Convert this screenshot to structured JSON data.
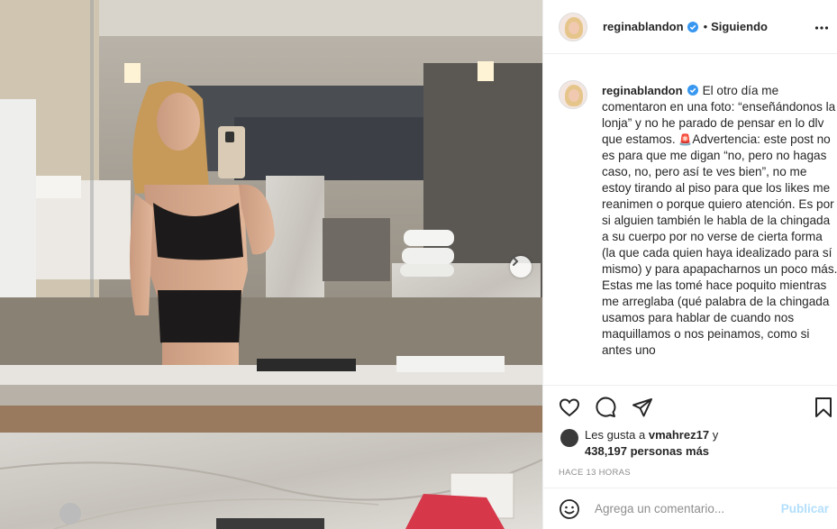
{
  "post": {
    "username": "reginablandon",
    "follow_status": "Siguiendo",
    "separator": "•",
    "caption": [
      "El otro día me comentaron en una foto: “enseñándonos la lonja” y no he parado de pensar en lo dlv que estamos. ",
      "Advertencia: este post no es para que me digan “no, pero no hagas caso, no, pero así te ves bien”, no me estoy tirando al piso para que los likes me reanimen o porque quiero atención. Es por si alguien también le habla de la chingada a su cuerpo por no verse de cierta forma (la que cada quien haya idealizado para sí mismo) y para apapacharnos un poco más.",
      "Estas me las tomé hace poquito mientras me arreglaba (qué palabra de la chingada usamos para hablar de cuando nos maquillamos o nos peinamos, como si antes uno"
    ],
    "warning_emoji": "🚨",
    "likes_prefix": "Les gusta a",
    "likes_user": "vmahrez17",
    "likes_joiner": "y",
    "likes_count": "438,197 personas más",
    "timestamp": "HACE 13 HORAS"
  },
  "comment": {
    "placeholder": "Agrega un comentario...",
    "publish_label": "Publicar"
  },
  "icons": {
    "verified": "verified-badge-icon",
    "more": "more-options-icon",
    "like": "heart-icon",
    "comment": "comment-icon",
    "share": "share-icon",
    "save": "bookmark-icon",
    "emoji": "emoji-icon",
    "next": "chevron-right-icon"
  },
  "colors": {
    "verified_blue": "#3897f0",
    "publish_disabled": "#b2dffc",
    "text": "#262626",
    "muted": "#8e8e8e"
  }
}
